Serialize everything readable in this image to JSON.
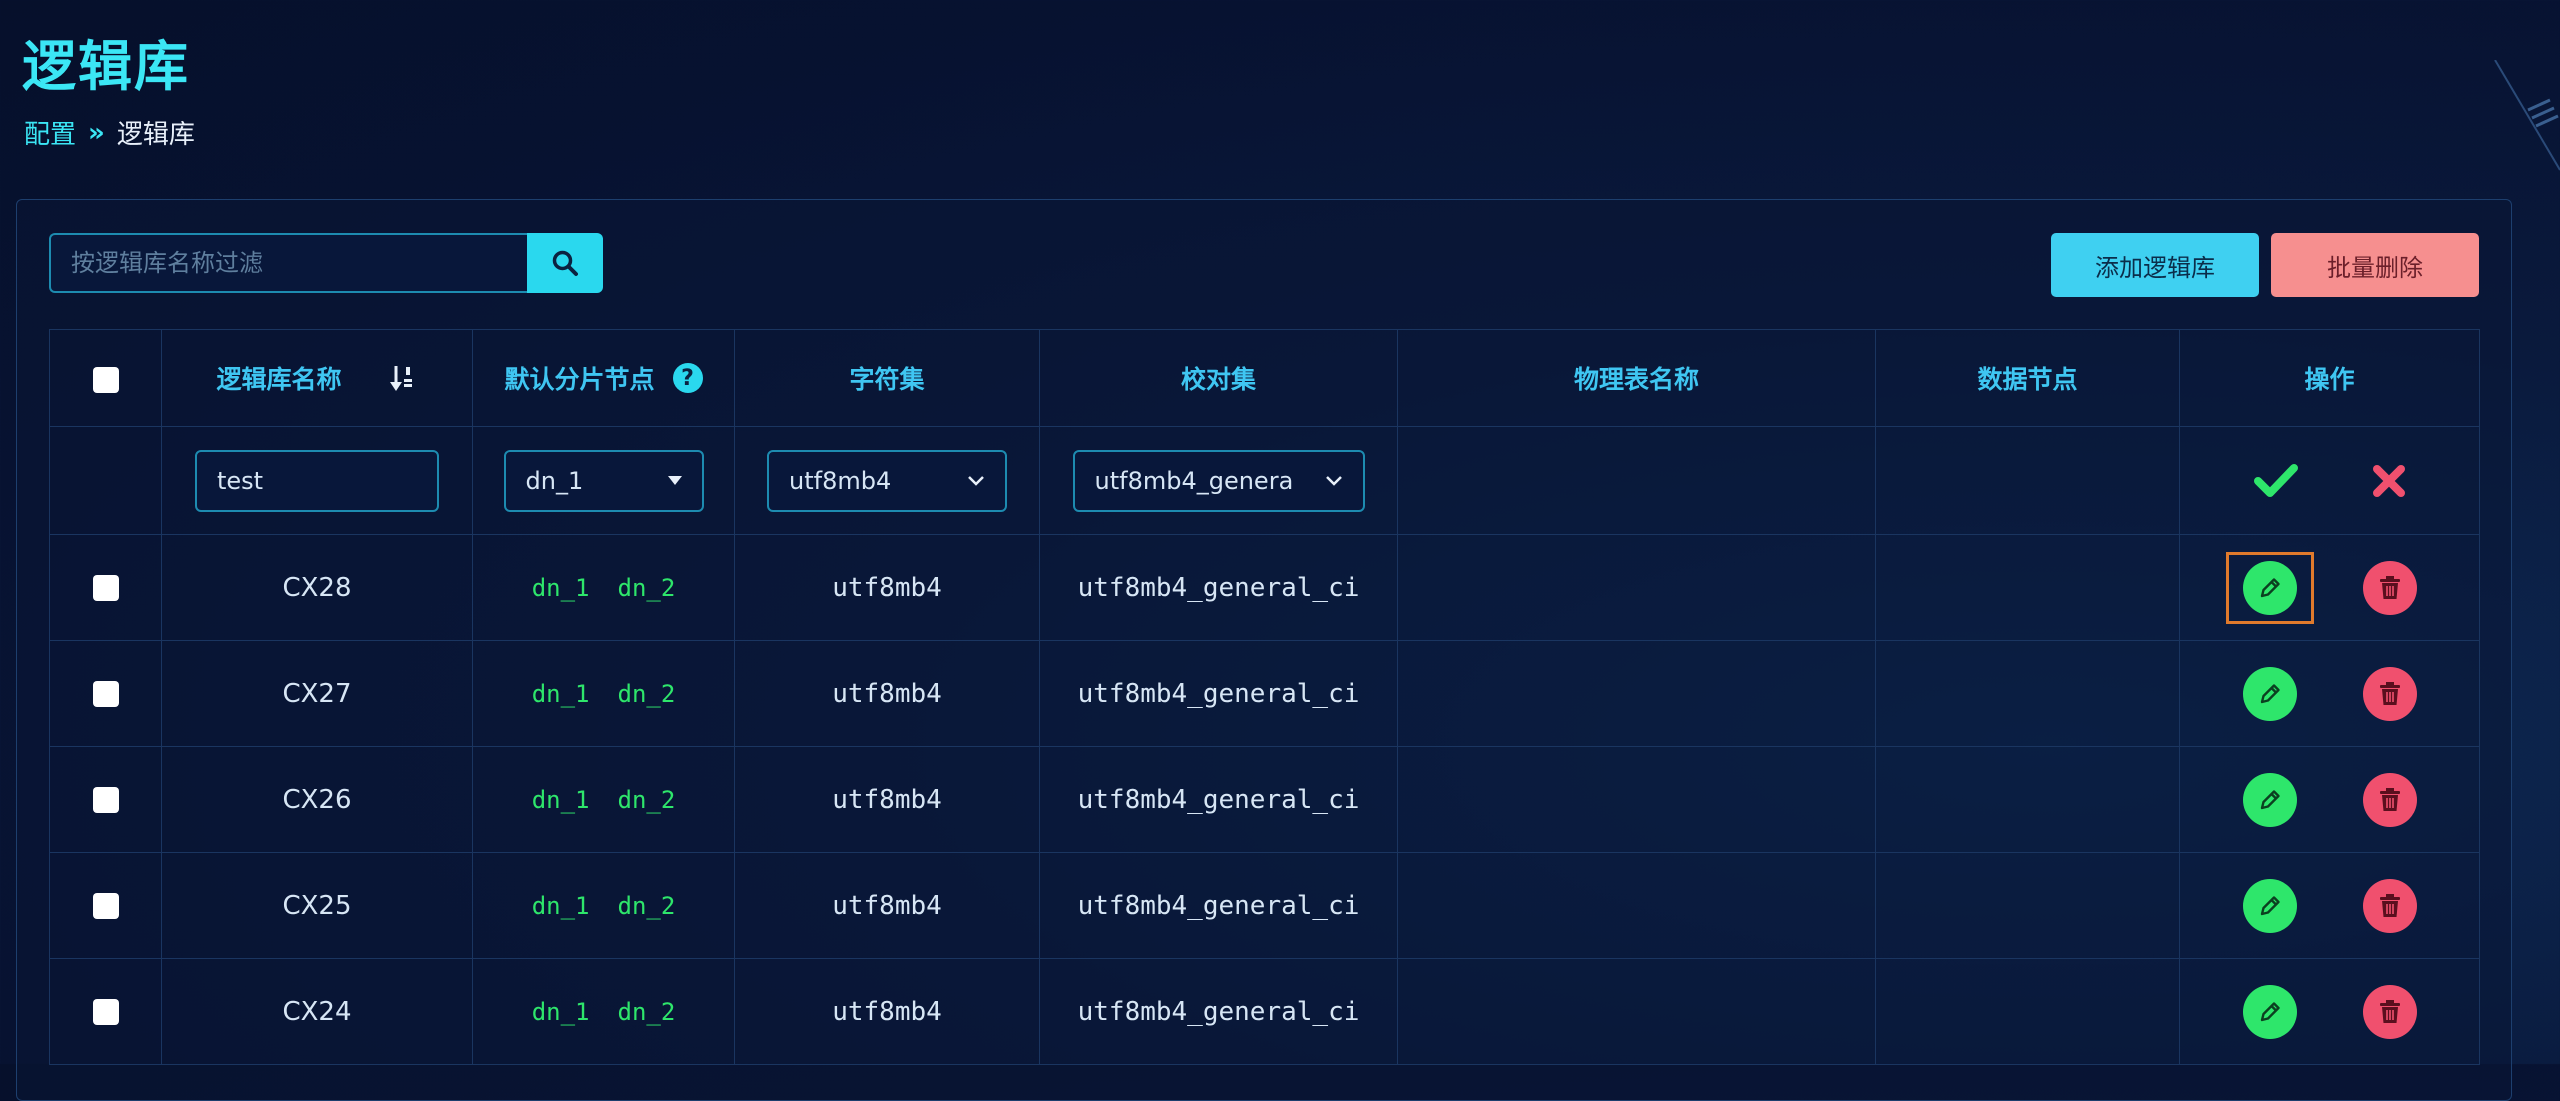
{
  "page": {
    "title": "逻辑库"
  },
  "breadcrumb": {
    "parent": "配置",
    "separator": "»",
    "current": "逻辑库"
  },
  "search": {
    "placeholder": "按逻辑库名称过滤",
    "icon": "search-icon"
  },
  "toolbar": {
    "add_label": "添加逻辑库",
    "batch_delete_label": "批量删除"
  },
  "colors": {
    "accent": "#2ad8ee",
    "add_button": "#3fd0f1",
    "delete_button": "#f68f8f",
    "node_tag": "#2ee66b",
    "edit_icon_bg": "#2ee66b",
    "delete_icon_bg": "#f0506e",
    "focus_outline": "#e07a2c"
  },
  "table": {
    "headers": {
      "name": "逻辑库名称",
      "default_node": "默认分片节点",
      "charset": "字符集",
      "collation": "校对集",
      "physical_table": "物理表名称",
      "data_node": "数据节点",
      "actions": "操作"
    },
    "edit_row": {
      "name_value": "test",
      "default_node_value": "dn_1",
      "charset_value": "utf8mb4",
      "collation_value": "utf8mb4_genera"
    },
    "rows": [
      {
        "name": "CX28",
        "nodes": [
          "dn_1",
          "dn_2"
        ],
        "charset": "utf8mb4",
        "collation": "utf8mb4_general_ci",
        "physical_table": "",
        "data_node": ""
      },
      {
        "name": "CX27",
        "nodes": [
          "dn_1",
          "dn_2"
        ],
        "charset": "utf8mb4",
        "collation": "utf8mb4_general_ci",
        "physical_table": "",
        "data_node": ""
      },
      {
        "name": "CX26",
        "nodes": [
          "dn_1",
          "dn_2"
        ],
        "charset": "utf8mb4",
        "collation": "utf8mb4_general_ci",
        "physical_table": "",
        "data_node": ""
      },
      {
        "name": "CX25",
        "nodes": [
          "dn_1",
          "dn_2"
        ],
        "charset": "utf8mb4",
        "collation": "utf8mb4_general_ci",
        "physical_table": "",
        "data_node": ""
      },
      {
        "name": "CX24",
        "nodes": [
          "dn_1",
          "dn_2"
        ],
        "charset": "utf8mb4",
        "collation": "utf8mb4_general_ci",
        "physical_table": "",
        "data_node": ""
      }
    ]
  }
}
